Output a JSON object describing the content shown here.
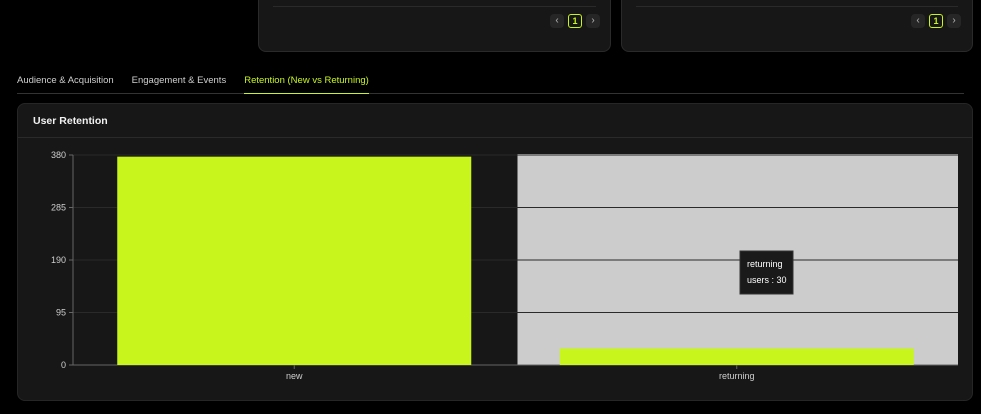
{
  "top_cards": [
    {
      "pager": {
        "prev": "‹",
        "page": "1",
        "next": "›"
      }
    },
    {
      "pager": {
        "prev": "‹",
        "page": "1",
        "next": "›"
      }
    }
  ],
  "tabs": [
    {
      "label": "Audience & Acquisition",
      "active": false
    },
    {
      "label": "Engagement & Events",
      "active": false
    },
    {
      "label": "Retention (New vs Returning)",
      "active": true
    }
  ],
  "card": {
    "title": "User Retention"
  },
  "colors": {
    "accent": "#c8f51c",
    "hover_bg": "#cccccc",
    "grid": "#2a2a2a"
  },
  "chart_data": {
    "type": "bar",
    "categories": [
      "new",
      "returning"
    ],
    "values": [
      377,
      30
    ],
    "ylim": [
      0,
      380
    ],
    "yticks": [
      "0",
      "95",
      "190",
      "285",
      "380"
    ],
    "hovered_index": 1,
    "tooltip": {
      "title": "returning",
      "line": "users : 30"
    }
  }
}
